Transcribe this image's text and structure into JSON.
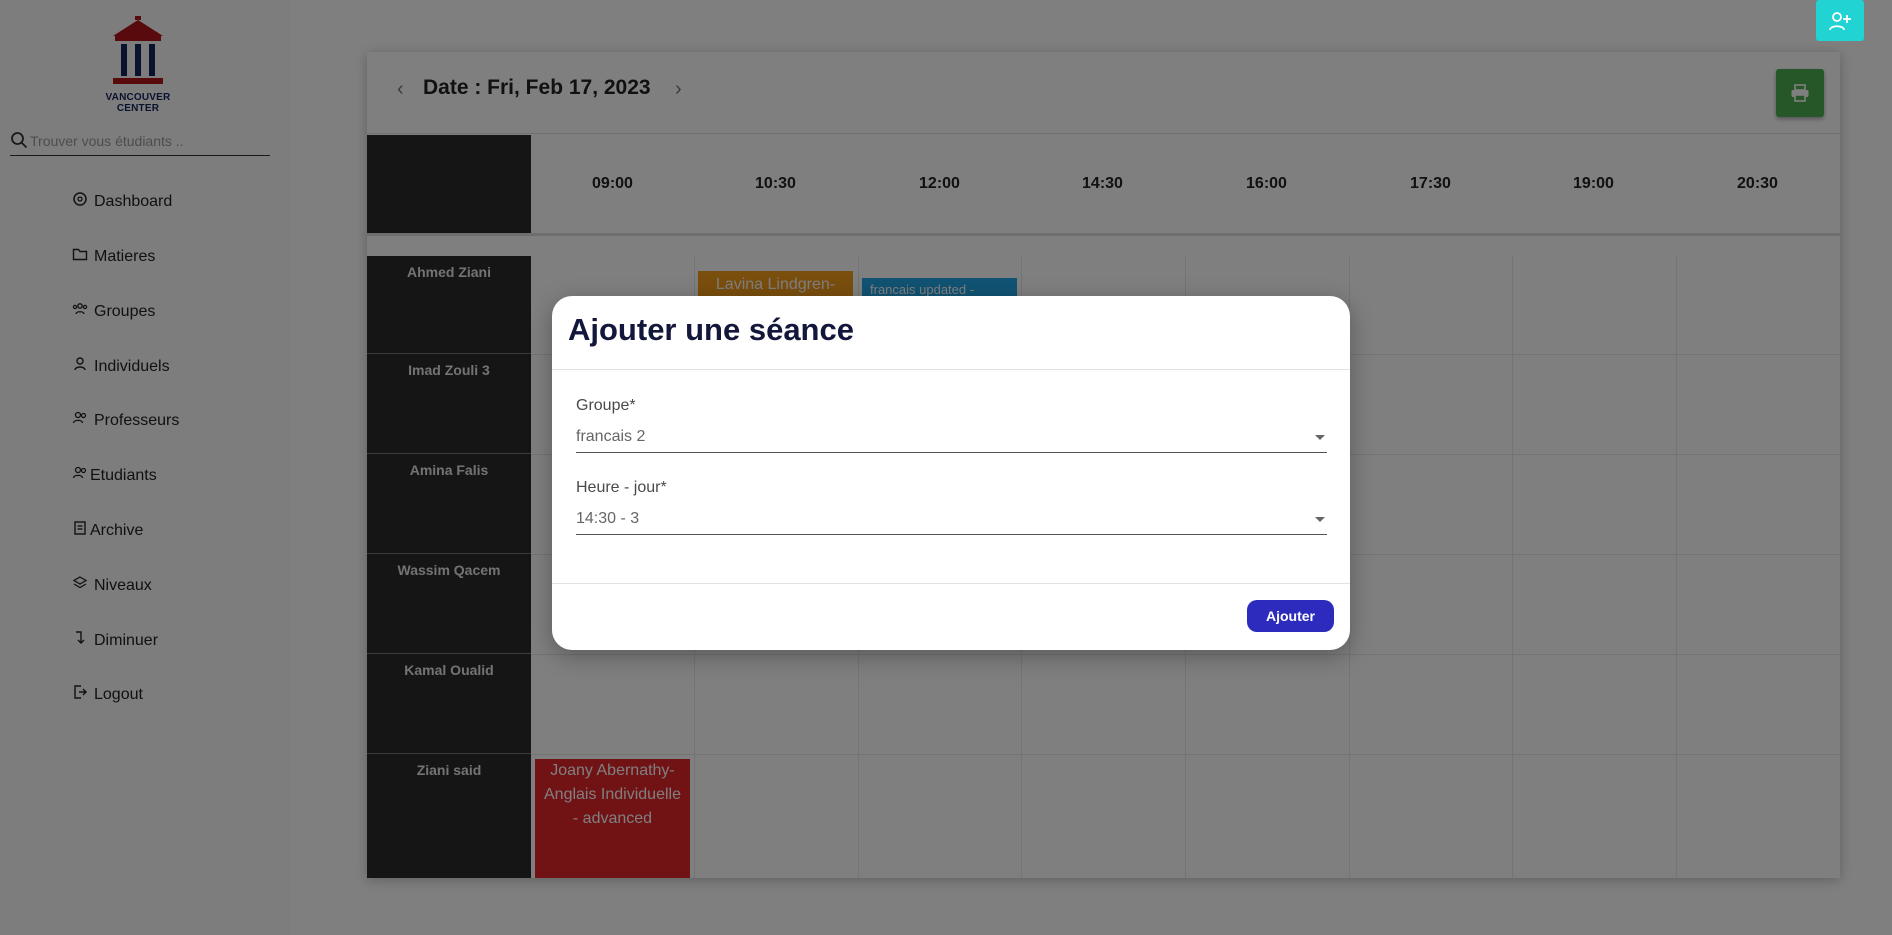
{
  "brand": {
    "name": "VANCOUVER CENTER"
  },
  "search": {
    "placeholder": "Trouver vous étudiants .."
  },
  "sidebar": {
    "items": [
      {
        "label": "Dashboard",
        "icon": "dashboard-icon"
      },
      {
        "label": "Matieres",
        "icon": "folder-icon"
      },
      {
        "label": "Groupes",
        "icon": "groups-icon"
      },
      {
        "label": "Individuels",
        "icon": "person-icon"
      },
      {
        "label": "Professeurs",
        "icon": "people-icon"
      },
      {
        "label": "Etudiants",
        "icon": "students-icon"
      },
      {
        "label": "Archive",
        "icon": "archive-icon"
      },
      {
        "label": "Niveaux",
        "icon": "layers-icon"
      },
      {
        "label": "Diminuer",
        "icon": "collapse-icon"
      },
      {
        "label": "Logout",
        "icon": "logout-icon"
      }
    ]
  },
  "schedule": {
    "date_label": "Date : Fri, Feb 17, 2023",
    "prev_label": "‹",
    "next_label": "›",
    "times": [
      "09:00",
      "10:30",
      "12:00",
      "14:30",
      "16:00",
      "17:30",
      "19:00",
      "20:30"
    ],
    "professors": [
      "Ahmed Ziani",
      "Imad Zouli 3",
      "Amina Falis",
      "Wassim Qacem",
      "Kamal Oualid",
      "Ziani said"
    ],
    "events": [
      {
        "text": "Lavina Lindgren-",
        "color": "#f59c1a"
      },
      {
        "text": "francais updated -",
        "color": "#22a6e8"
      },
      {
        "text": "Joany Abernathy-Anglais Individuelle - advanced",
        "color": "#e3242b"
      }
    ]
  },
  "colors": {
    "print_button": "#4caf50",
    "add_user_button": "#22d3d3",
    "modal_primary": "#2d2bbd"
  },
  "modal": {
    "title": "Ajouter une séance",
    "groupe_label": "Groupe*",
    "groupe_value": "francais 2",
    "heure_label": "Heure - jour*",
    "heure_value": "14:30 - 3",
    "submit_label": "Ajouter"
  }
}
